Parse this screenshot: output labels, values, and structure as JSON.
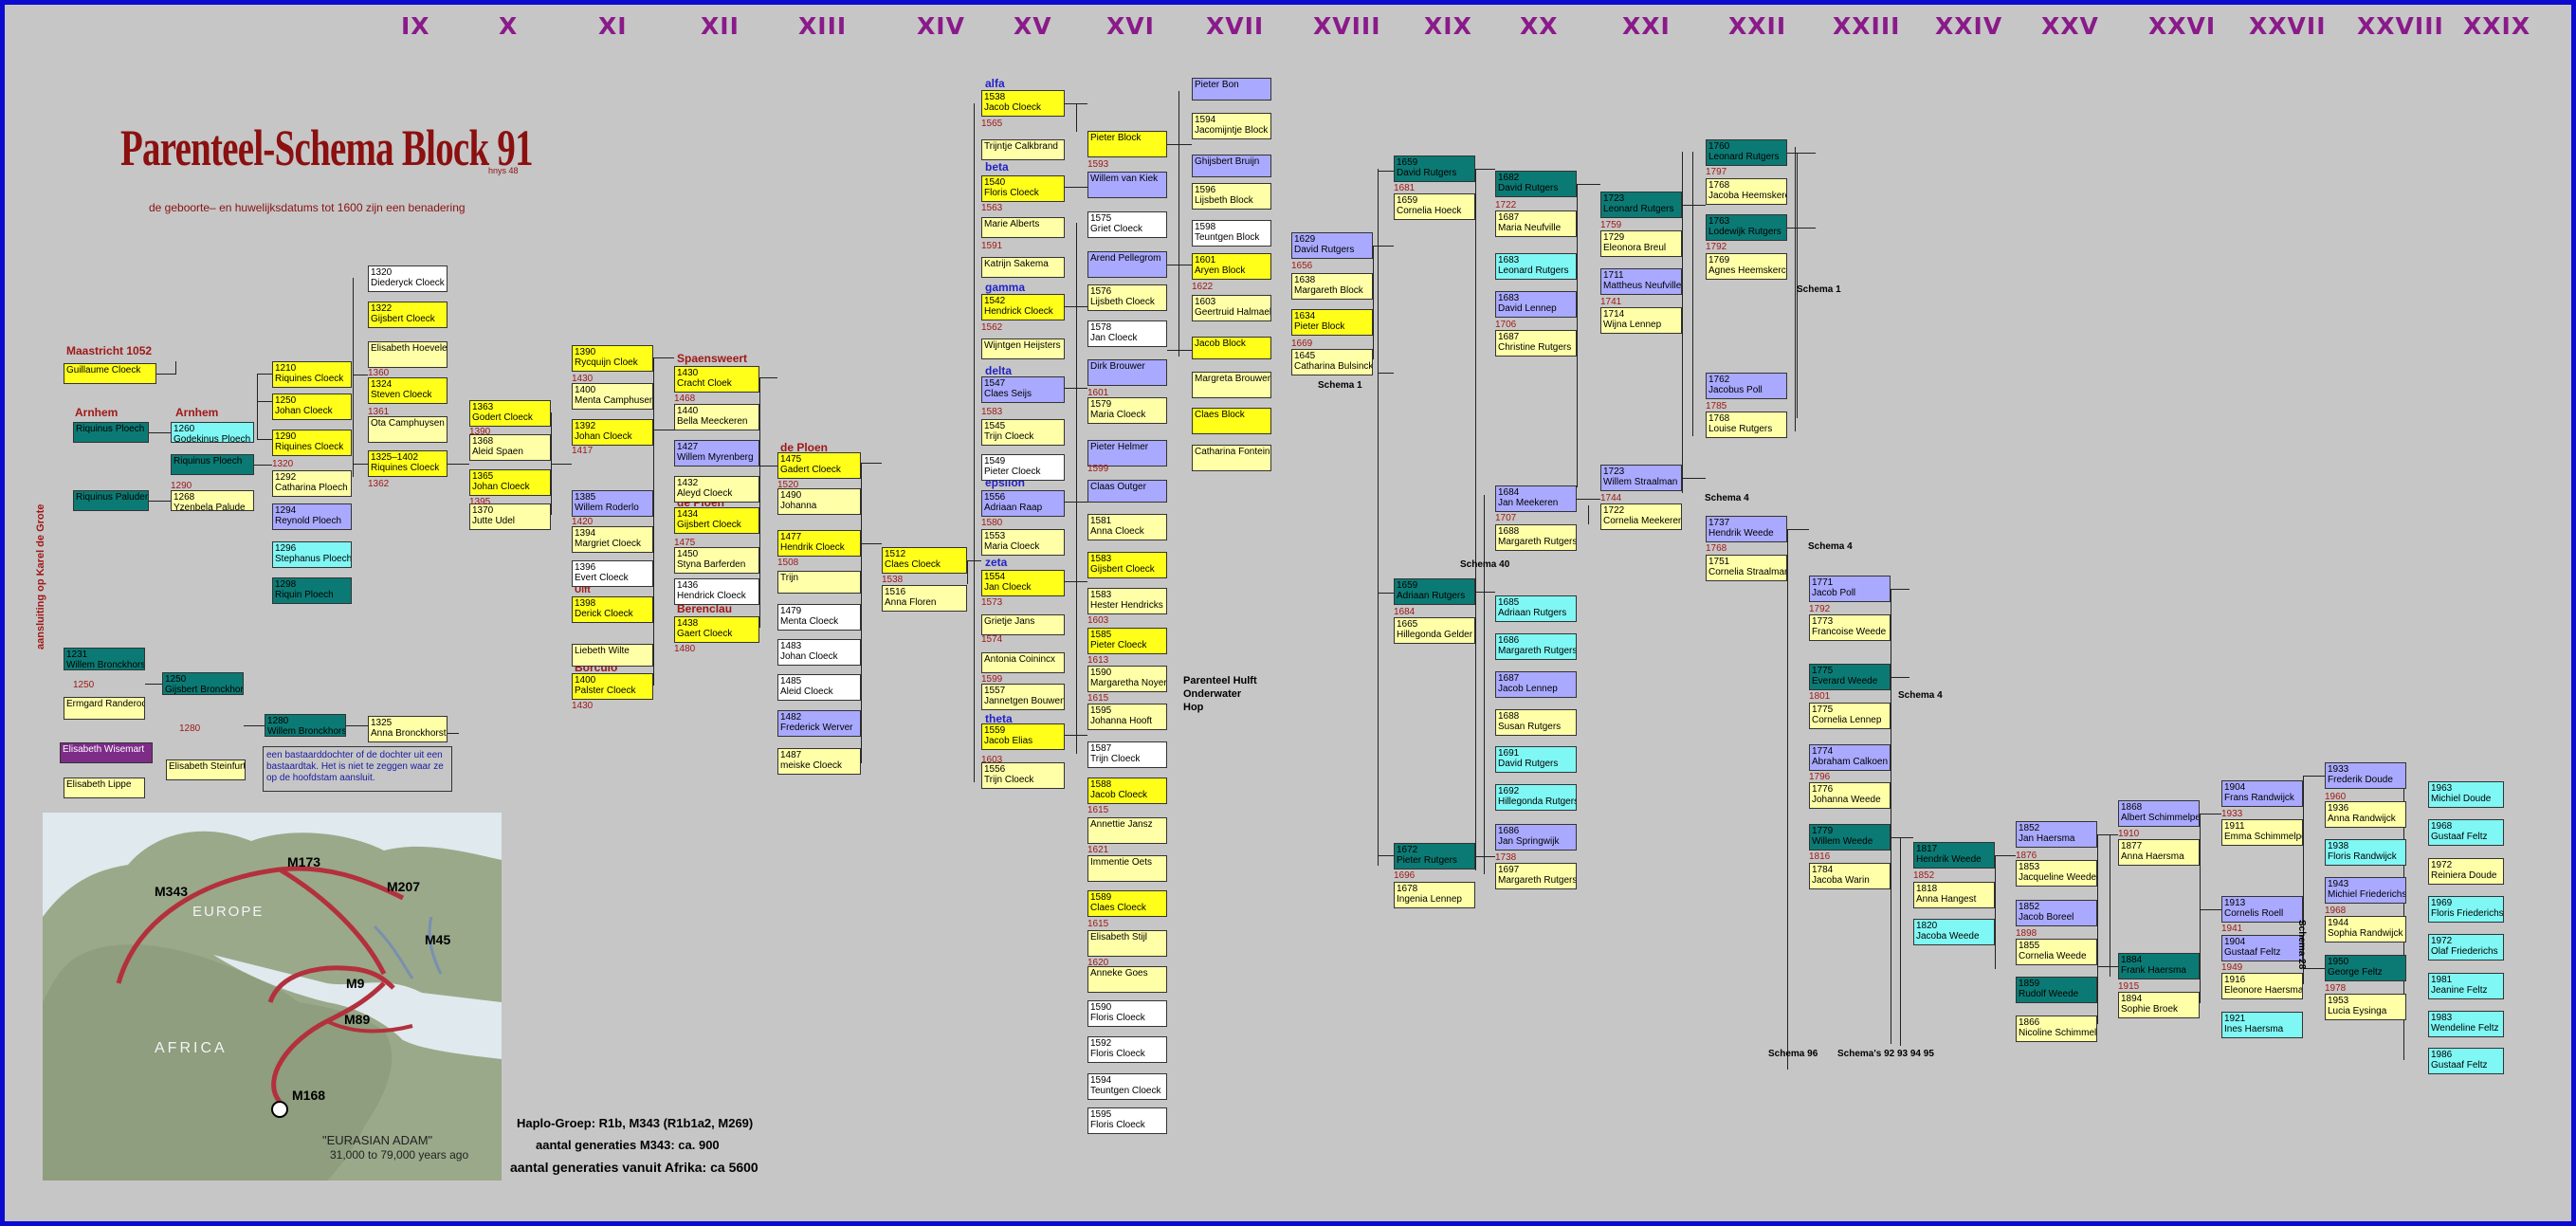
{
  "title": "Parenteel-Schema Block 91",
  "title_tag": "hnys 48",
  "subtitle": "de geboorte– en huwelijksdatums tot 1600 zijn een benadering",
  "generations": [
    "IX",
    "X",
    "XI",
    "XII",
    "XIII",
    "XIV",
    "XV",
    "XVI",
    "XVII",
    "XVIII",
    "XIX",
    "XX",
    "XXI",
    "XXII",
    "XXIII",
    "XXIV",
    "XXV",
    "XXVI",
    "XXVII",
    "XXVIII",
    "XXIX"
  ],
  "places": {
    "maastricht": "Maastricht 1052",
    "arnhem1": "Arnhem",
    "arnhem2": "Arnhem",
    "spaensweert": "Spaensweert",
    "de_ploen1": "de Ploen",
    "de_ploen2": "de Ploen",
    "berenclau": "Berenclau",
    "borculo": "Borculo",
    "ulft": "Ulft"
  },
  "greek": {
    "alfa": "alfa",
    "beta": "beta",
    "gamma": "gamma",
    "delta": "delta",
    "epsilon": "epsilon",
    "zeta": "zeta",
    "theta": "theta"
  },
  "boxes": {
    "b1": "Guillaume Cloeck",
    "b2": "Riquinus Ploech",
    "b3": "Riquinus Paluden",
    "b4y": "1260",
    "b4": "Godekinus Ploech",
    "b5": "Riquinus Ploech",
    "b6y": "1268",
    "b6": "Yzenbela Palude",
    "b7y": "1210",
    "b7": "Riquines Cloeck",
    "b8y": "1250",
    "b8": "Johan Cloeck",
    "b9y": "1290",
    "b9": "Riquines Cloeck",
    "b10y": "1292",
    "b10": "Catharina Ploech",
    "b11y": "1294",
    "b11": "Reynold Ploech",
    "b12y": "1296",
    "b12": "Stephanus Ploech",
    "b13y": "1298",
    "b13": "Riquin Ploech",
    "b14y": "1320",
    "b14": "Diederyck Cloeck",
    "b15y": "1322",
    "b15": "Gijsbert Cloeck",
    "b16": "Elisabeth Hoeveleek",
    "b17y": "1324",
    "b17": "Steven Cloeck",
    "b18": "Ota Camphuysen",
    "b19y": "1325–1402",
    "b19": "Riquines Cloeck",
    "b20y": "1363",
    "b20": "Godert Cloeck",
    "b21y": "1368",
    "b21": "Aleid Spaen",
    "b22y": "1365",
    "b22": "Johan Cloeck",
    "b23y": "1370",
    "b23": "Jutte Udel",
    "b24y": "1390",
    "b24": "Rycquijn Cloek",
    "b25y": "1400",
    "b25": "Menta Camphusen",
    "b26y": "1392",
    "b26": "Johan Cloeck",
    "b27y": "1385",
    "b27": "Willem Roderlo",
    "b28y": "1394",
    "b28": "Margriet Cloeck",
    "b29y": "1396",
    "b29": "Evert Cloeck",
    "b30y": "1398",
    "b30": "Derick Cloeck",
    "b31": "Liebeth Wilte",
    "b32y": "1400",
    "b32": "Palster Cloeck",
    "b33y": "1430",
    "b33": "Cracht Cloek",
    "b34y": "1440",
    "b34": "Bella Meeckeren",
    "b35y": "1427",
    "b35": "Willem Myrenberg",
    "b36y": "1432",
    "b36": "Aleyd Cloeck",
    "b37y": "1434",
    "b37": "Gijsbert Cloeck",
    "b38y": "1450",
    "b38": "Styna Barferden",
    "b39y": "1436",
    "b39": "Hendrick Cloeck",
    "b40y": "1438",
    "b40": "Gaert Cloeck",
    "b41y": "1475",
    "b41": "Gadert Cloeck",
    "b42y": "1490",
    "b42": "Johanna",
    "b43y": "1477",
    "b43": "Hendrik Cloeck",
    "b44": "Trijn",
    "b45y": "1479",
    "b45": "Menta Cloeck",
    "b46y": "1483",
    "b46": "Johan Cloeck",
    "b47y": "1485",
    "b47": "Aleid Cloeck",
    "b48y": "1482",
    "b48": "Frederick Werver",
    "b49y": "1487",
    "b49": "meiske Cloeck",
    "b50y": "1512",
    "b50": "Claes Cloeck",
    "b51y": "1516",
    "b51": "Anna Floren",
    "b52y": "1231",
    "b52": "Willem Bronckhorst",
    "b53": "Ermgard Randerode",
    "b54y": "1250",
    "b54": "Gijsbert Bronckhorst",
    "b55y": "1280",
    "b55": "Willem Bronckhorst",
    "b56": "Elisabeth Wisemart",
    "b57": "Elisabeth Steinfurt",
    "b58": "Elisabeth Lippe",
    "b59y": "1325",
    "b59": "Anna Bronckhorst",
    "note": "een bastaarddochter of de dochter uit een bastaardtak. Het is niet te zeggen waar ze op de hoofdstam aansluit.",
    "karel": "aansluiting op Karel de Grote",
    "c1y": "1538",
    "c1": "Jacob Cloeck",
    "c2": "Trijntje Calkbrand",
    "c3y": "1540",
    "c3": "Floris Cloeck",
    "c4": "Marie Alberts",
    "c5": "Katrijn Sakema",
    "c6y": "1542",
    "c6": "Hendrick Cloeck",
    "c7": "Wijntgen Heijsters",
    "c8y": "1547",
    "c8": "Claes Seijs",
    "c9y": "1545",
    "c9": "Trijn Cloeck",
    "c10y": "1549",
    "c10": "Pieter Cloeck",
    "c11y": "1556",
    "c11": "Adriaan Raap",
    "c12y": "1553",
    "c12": "Maria Cloeck",
    "c13y": "1554",
    "c13": "Jan Cloeck",
    "c14": "Grietje Jans",
    "c15": "Antonia Coinincx",
    "c16y": "1557",
    "c16": "Jannetgen Bouwens",
    "c17y": "1559",
    "c17": "Jacob Elias",
    "c18y": "1556",
    "c18": "Trijn Cloeck",
    "d1": "Pieter Block",
    "d2": "Willem van Kiek",
    "d3y": "1575",
    "d3": "Griet Cloeck",
    "d4": "Arend Pellegrom",
    "d5y": "1576",
    "d5": "Lijsbeth Cloeck",
    "d6y": "1578",
    "d6": "Jan Cloeck",
    "d7": "Dirk Brouwer",
    "d8y": "1579",
    "d8": "Maria Cloeck",
    "d9": "Pieter Helmer",
    "d10": "Claas Outger",
    "d11y": "1581",
    "d11": "Anna Cloeck",
    "d12y": "1583",
    "d12": "Gijsbert Cloeck",
    "d13y": "1583",
    "d13": "Hester Hendricks",
    "d14y": "1585",
    "d14": "Pieter Cloeck",
    "d15y": "1590",
    "d15": "Margaretha Noyer",
    "d16y": "1595",
    "d16": "Johanna Hooft",
    "d17y": "1587",
    "d17": "Trijn Cloeck",
    "d18y": "1588",
    "d18": "Jacob Cloeck",
    "d19": "Annettie Jansz",
    "d20": "Immentie Oets",
    "d21y": "1589",
    "d21": "Claes Cloeck",
    "d22": "Elisabeth Stijl",
    "d23": "Anneke Goes",
    "d24y": "1590",
    "d24": "Floris Cloeck",
    "d25y": "1592",
    "d25": "Floris Cloeck",
    "d26y": "1594",
    "d26": "Teuntgen Cloeck",
    "d27y": "1595",
    "d27": "Floris Cloeck",
    "parenteel": "Parenteel Hulft Onderwater Hop",
    "e1": "Pieter Bon",
    "e2y": "1594",
    "e2": "Jacomijntje Block",
    "e3": "Ghijsbert Bruijn",
    "e4y": "1596",
    "e4": "Lijsbeth Block",
    "e5y": "1598",
    "e5": "Teuntgen Block",
    "e6y": "1601",
    "e6": "Aryen Block",
    "e7y": "1603",
    "e7": "Geertruid Halmael",
    "e8": "Jacob Block",
    "e9": "Margreta Brouwers",
    "e10": "Claes Block",
    "e11": "Catharina Fontein",
    "f1y": "1629",
    "f1": "David Rutgers",
    "f2y": "1638",
    "f2": "Margareth Block",
    "f3y": "1634",
    "f3": "Pieter Block",
    "f4y": "1645",
    "f4": "Catharina Bulsinck",
    "schema1a": "Schema 1",
    "g1y": "1659",
    "g1": "David Rutgers",
    "g2y": "1659",
    "g2": "Cornelia Hoeck",
    "g3y": "1659",
    "g3": "Adriaan Rutgers",
    "g4y": "1665",
    "g4": "Hillegonda Gelder",
    "g5y": "1672",
    "g5": "Pieter Rutgers",
    "g6y": "1678",
    "g6": "Ingenia Lennep",
    "h1y": "1682",
    "h1": "David Rutgers",
    "h2y": "1687",
    "h2": "Maria Neufville",
    "h3y": "1683",
    "h3": "Leonard Rutgers",
    "h4y": "1683",
    "h4": "David Lennep",
    "h5y": "1687",
    "h5": "Christine Rutgers",
    "h6y": "1684",
    "h6": "Jan Meekeren",
    "h7y": "1688",
    "h7": "Margareth Rutgers",
    "schema40": "Schema 40",
    "h8y": "1685",
    "h8": "Adriaan Rutgers",
    "h9y": "1686",
    "h9": "Margareth Rutgers",
    "h10y": "1687",
    "h10": "Jacob Lennep",
    "h11y": "1688",
    "h11": "Susan Rutgers",
    "h12y": "1691",
    "h12": "David Rutgers",
    "h13y": "1692",
    "h13": "Hillegonda Rutgers",
    "h14y": "1686",
    "h14": "Jan Springwijk",
    "h15y": "1697",
    "h15": "Margareth Rutgers",
    "i1y": "1723",
    "i1": "Leonard Rutgers",
    "i2y": "1729",
    "i2": "Eleonora Breul",
    "i3y": "1711",
    "i3": "Mattheus Neufville",
    "i4y": "1714",
    "i4": "Wijna Lennep",
    "i5y": "1723",
    "i5": "Willem Straalman",
    "i6y": "1722",
    "i6": "Cornelia Meekeren",
    "schema4a": "Schema 4",
    "j1y": "1760",
    "j1": "Leonard Rutgers",
    "j2y": "1768",
    "j2": "Jacoba Heemskerck",
    "j3y": "1763",
    "j3": "Lodewijk Rutgers",
    "j4y": "1769",
    "j4": "Agnes Heemskerck",
    "schema1b": "Schema 1",
    "j5y": "1762",
    "j5": "Jacobus Poll",
    "j6y": "1768",
    "j6": "Louise Rutgers",
    "j7y": "1737",
    "j7": "Hendrik Weede",
    "j8y": "1751",
    "j8": "Cornelia Straalman",
    "schema4b": "Schema 4",
    "k1y": "1771",
    "k1": "Jacob Poll",
    "k2y": "1773",
    "k2": "Francoise Weede",
    "k3y": "1775",
    "k3": "Everard Weede",
    "k4y": "1775",
    "k4": "Cornelia Lennep",
    "schema4c": "Schema 4",
    "k5y": "1774",
    "k5": "Abraham Calkoen",
    "k6y": "1776",
    "k6": "Johanna Weede",
    "k7y": "1779",
    "k7": "Willem Weede",
    "k8y": "1784",
    "k8": "Jacoba Warin",
    "schema96": "Schema 96",
    "schemas": "Schema's 92 93 94 95",
    "l1y": "1817",
    "l1": "Hendrik Weede",
    "l2y": "1818",
    "l2": "Anna Hangest",
    "l3y": "1820",
    "l3": "Jacoba Weede",
    "m1y": "1852",
    "m1": "Jan Haersma",
    "m2y": "1853",
    "m2": "Jacqueline Weede",
    "m3y": "1852",
    "m3": "Jacob Boreel",
    "m4y": "1855",
    "m4": "Cornelia Weede",
    "m5y": "1859",
    "m5": "Rudolf Weede",
    "m6y": "1866",
    "m6": "Nicoline Schimmelpenninck",
    "n1y": "1868",
    "n1": "Albert Schimmelpenninck",
    "n2y": "1877",
    "n2": "Anna Haersma",
    "n3y": "1884",
    "n3": "Frank Haersma",
    "n4y": "1894",
    "n4": "Sophie Broek",
    "o1y": "1904",
    "o1": "Frans Randwijck",
    "o2y": "1911",
    "o2": "Emma Schimmelpenninck",
    "schema28": "Schema 28",
    "o3y": "1913",
    "o3": "Cornelis Roell",
    "o4y": "1904",
    "o4": "Gustaaf Feltz",
    "o5y": "1916",
    "o5": "Eleonore Haersma",
    "o6y": "1921",
    "o6": "Ines Haersma",
    "p1y": "1933",
    "p1": "Frederik Doude",
    "p2y": "1936",
    "p2": "Anna Randwijck",
    "p3y": "1938",
    "p3": "Floris Randwijck",
    "p4y": "1943",
    "p4": "Michiel Friederichs",
    "p5y": "1944",
    "p5": "Sophia Randwijck",
    "p6y": "1950",
    "p6": "George Feltz",
    "p7y": "1953",
    "p7": "Lucia Eysinga",
    "q1y": "1963",
    "q1": "Michiel Doude",
    "q2y": "1968",
    "q2": "Gustaaf Feltz",
    "q3y": "1972",
    "q3": "Reiniera Doude",
    "q4y": "1969",
    "q4": "Floris Friederichs",
    "q5y": "1972",
    "q5": "Olaf Friederichs",
    "q6y": "1981",
    "q6": "Jeanine Feltz",
    "q7y": "1983",
    "q7": "Wendeline Feltz",
    "q8y": "1986",
    "q8": "Gustaaf Feltz"
  },
  "red_years": {
    "r1": "1250",
    "r2": "1290",
    "r3": "1320",
    "r4": "1362",
    "r5": "1360",
    "r6": "1361",
    "r7": "1390",
    "r8": "1395",
    "r9": "1430",
    "r10": "1417",
    "r11": "1420",
    "r12": "1430",
    "r13": "1468",
    "r14": "1475",
    "r15": "1480",
    "r16": "1520",
    "r17": "1508",
    "r18": "1538",
    "r19": "1565",
    "r20": "1563",
    "r21": "1591",
    "r22": "1562",
    "r23": "1583",
    "r24": "1580",
    "r25": "1573",
    "r26": "1574",
    "r27": "1599",
    "r28": "1603",
    "r29": "1593",
    "r30": "1601",
    "r31": "1599",
    "r32": "1603",
    "r33": "1613",
    "r34": "1615",
    "r35": "1615",
    "r36": "1621",
    "r37": "1615",
    "r38": "1620",
    "r39": "1622",
    "r40": "1656",
    "r41": "1669",
    "r42": "1681",
    "r43": "1684",
    "r44": "1696",
    "r45": "1722",
    "r46": "1706",
    "r47": "1707",
    "r48": "1738",
    "r49": "1759",
    "r50": "1741",
    "r51": "1744",
    "r52": "1797",
    "r53": "1792",
    "r54": "1785",
    "r55": "1768",
    "r56": "1792",
    "r57": "1801",
    "r58": "1796",
    "r59": "1816",
    "r60": "1852",
    "r61": "1876",
    "r62": "1898",
    "r63": "1910",
    "r64": "1915",
    "r65": "1933",
    "r66": "1941",
    "r67": "1949",
    "r68": "1960",
    "r69": "1968",
    "r70": "1978",
    "r71": "1280"
  },
  "map_labels": {
    "m343": "M343",
    "m173": "M173",
    "m207": "M207",
    "m45": "M45",
    "m9": "M9",
    "m89": "M89",
    "m168": "M168",
    "europe": "EUROPE",
    "africa": "AFRICA",
    "adam": "\"EURASIAN ADAM\"",
    "adam_years": "31,000 to 79,000 years ago"
  },
  "haplo": {
    "line1": "Haplo-Groep: R1b, M343 (R1b1a2, M269)",
    "line2": "aantal generaties M343: ca. 900",
    "line3": "aantal generaties vanuit Afrika: ca 5600"
  },
  "colors": {
    "border": "#0b0bd0",
    "background": "#c6c6c6",
    "generation_header": "#8a1a8a",
    "title": "#8b1010",
    "yellow": "#ffff1a",
    "light_yellow": "#ffffa8",
    "lavender": "#a9a9ff",
    "teal": "#0b7a74",
    "cyan": "#7ff7f4",
    "purple": "#7d2c88",
    "white": "#ffffff",
    "greek_label": "#2222c8",
    "date_red": "#a01818"
  }
}
